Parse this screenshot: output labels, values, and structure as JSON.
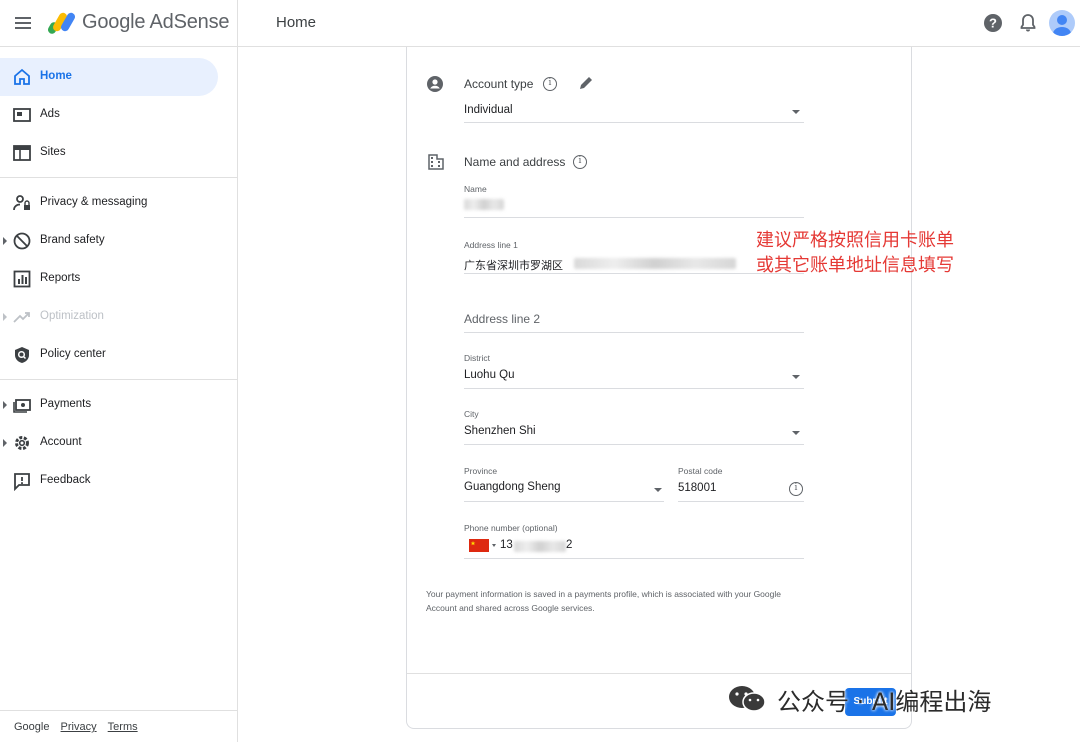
{
  "header": {
    "brand": "Google AdSense",
    "page_title": "Home"
  },
  "sidebar": {
    "items": [
      {
        "label": "Home",
        "icon": "home-icon"
      },
      {
        "label": "Ads",
        "icon": "ads-icon"
      },
      {
        "label": "Sites",
        "icon": "sites-icon"
      },
      {
        "label": "Privacy & messaging",
        "icon": "privacy-icon"
      },
      {
        "label": "Brand safety",
        "icon": "block-icon"
      },
      {
        "label": "Reports",
        "icon": "reports-icon"
      },
      {
        "label": "Optimization",
        "icon": "trending-icon"
      },
      {
        "label": "Policy center",
        "icon": "policy-shield-icon"
      },
      {
        "label": "Payments",
        "icon": "payments-icon"
      },
      {
        "label": "Account",
        "icon": "gear-icon"
      },
      {
        "label": "Feedback",
        "icon": "feedback-icon"
      }
    ],
    "footer": {
      "google": "Google",
      "privacy": "Privacy",
      "terms": "Terms"
    }
  },
  "form": {
    "account_type": {
      "title": "Account type",
      "value": "Individual"
    },
    "name_address": {
      "title": "Name and address"
    },
    "name": {
      "label": "Name"
    },
    "address1": {
      "label": "Address line 1",
      "value": "广东省深圳市罗湖区"
    },
    "address2": {
      "placeholder": "Address line 2"
    },
    "district": {
      "label": "District",
      "value": "Luohu Qu"
    },
    "city": {
      "label": "City",
      "value": "Shenzhen Shi"
    },
    "province": {
      "label": "Province",
      "value": "Guangdong Sheng"
    },
    "postal": {
      "label": "Postal code",
      "value": "518001"
    },
    "phone": {
      "label": "Phone number (optional)",
      "prefix": "13",
      "suffix": "2"
    },
    "disclaimer": "Your payment information is saved in a payments profile, which is associated with your Google Account and shared across Google services.",
    "submit": "Submit"
  },
  "annotation": {
    "line1": "建议严格按照信用卡账单",
    "line2": "或其它账单地址信息填写"
  },
  "watermark": {
    "text": "公众号 · AI编程出海"
  },
  "colors": {
    "accent": "#1a73e8",
    "annotation": "#e53935",
    "active_bg": "#e8f0fe"
  }
}
